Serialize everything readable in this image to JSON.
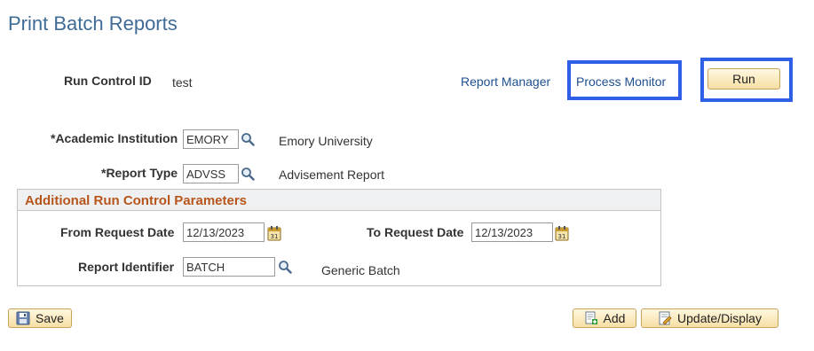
{
  "page": {
    "title": "Print Batch Reports"
  },
  "run_control": {
    "label": "Run Control ID",
    "value": "test"
  },
  "links": {
    "report_manager": "Report Manager",
    "process_monitor": "Process Monitor"
  },
  "buttons": {
    "run": "Run",
    "save": "Save",
    "add": "Add",
    "update_display": "Update/Display"
  },
  "fields": {
    "academic_institution": {
      "label": "*Academic Institution",
      "value": "EMORY",
      "description": "Emory University"
    },
    "report_type": {
      "label": "*Report Type",
      "value": "ADVSS",
      "description": "Advisement Report"
    }
  },
  "additional_params": {
    "title": "Additional Run Control Parameters",
    "from_request_date": {
      "label": "From Request Date",
      "value": "12/13/2023"
    },
    "to_request_date": {
      "label": "To Request Date",
      "value": "12/13/2023"
    },
    "report_identifier": {
      "label": "Report Identifier",
      "value": "BATCH",
      "description": "Generic Batch"
    }
  },
  "icons": {
    "lookup": "magnifier-icon",
    "calendar": "calendar-icon",
    "save": "floppy-disk-icon",
    "add": "add-document-icon",
    "update": "pencil-document-icon"
  },
  "colors": {
    "title": "#3f6b96",
    "link": "#1e4f8f",
    "highlight": "#2f5fe6",
    "group_title": "#b8551b",
    "button_border": "#c9a25c"
  }
}
